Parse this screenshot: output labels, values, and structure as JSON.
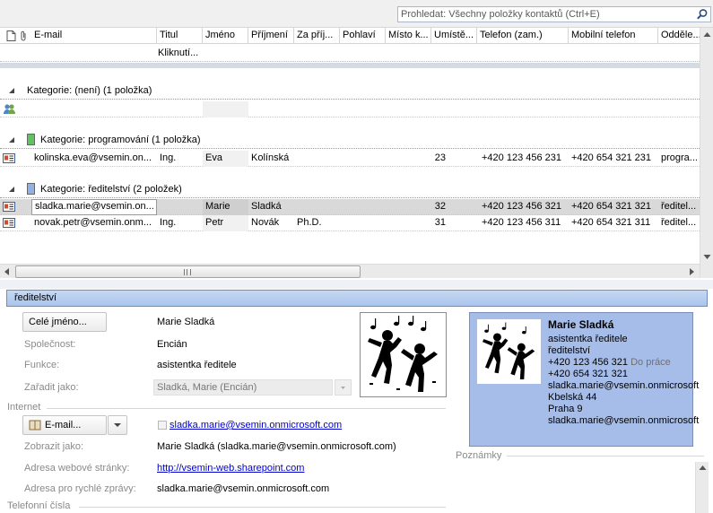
{
  "search": {
    "placeholder": "Prohledat: Všechny položky kontaktů (Ctrl+E)"
  },
  "columns": [
    "E-mail",
    "Titul",
    "Jméno",
    "Příjmení",
    "Za příj...",
    "Pohlaví",
    "Místo k...",
    "Umístě...",
    "Telefon (zam.)",
    "Mobilní telefon",
    "Odděle..."
  ],
  "filter_row": {
    "click_text": "Kliknutí..."
  },
  "groups": [
    {
      "label": "Kategorie: (není) (1 položka)"
    },
    {
      "label": "Kategorie: programování (1 položka)",
      "color": "#5fc35f"
    },
    {
      "label": "Kategorie: ředitelství (2 položek)",
      "color": "#8fb0e8"
    }
  ],
  "rows": [
    {
      "email": "kolinska.eva@vsemin.on...",
      "titul": "Ing.",
      "jmeno": "Eva",
      "prijmeni": "Kolínská",
      "za_prijmeni": "",
      "umisteni": "23",
      "telefon": "+420 123 456 231",
      "mobil": "+420 654 321 231",
      "oddeleni": "progra..."
    },
    {
      "email": "sladka.marie@vsemin.on...",
      "titul": "",
      "jmeno": "Marie",
      "prijmeni": "Sladká",
      "za_prijmeni": "",
      "umisteni": "32",
      "telefon": "+420 123 456 321",
      "mobil": "+420 654 321 321",
      "oddeleni": "ředitel...",
      "selected": true
    },
    {
      "email": "novak.petr@vsemin.onm...",
      "titul": "Ing.",
      "jmeno": "Petr",
      "prijmeni": "Novák",
      "za_prijmeni": "Ph.D.",
      "umisteni": "31",
      "telefon": "+420 123 456 311",
      "mobil": "+420 654 321 311",
      "oddeleni": "ředitel..."
    }
  ],
  "detail": {
    "title": "ředitelství",
    "fullname_button": "Celé jméno...",
    "fullname": "Marie Sladká",
    "company_label": "Společnost:",
    "company": "Encián",
    "function_label": "Funkce:",
    "function": "asistentka ředitele",
    "fileas_label": "Zařadit jako:",
    "fileas": "Sladká, Marie (Encián)",
    "internet_section": "Internet",
    "email_button": "E-mail...",
    "email": "sladka.marie@vsemin.onmicrosoft.com",
    "display_label": "Zobrazit jako:",
    "display": "Marie Sladká (sladka.marie@vsemin.onmicrosoft.com)",
    "web_label": "Adresa webové stránky:",
    "web": "http://vsemin-web.sharepoint.com",
    "im_label": "Adresa pro rychlé zprávy:",
    "im": "sladka.marie@vsemin.onmicrosoft.com",
    "phones_section": "Telefonní čísla",
    "notes_label": "Poznámky"
  },
  "card": {
    "name": "Marie Sladká",
    "function": "asistentka ředitele",
    "department": "ředitelství",
    "phone_work": "+420 123 456 321",
    "phone_work_label": "Do práce",
    "phone_mobile": "+420 654 321 321",
    "email1": "sladka.marie@vsemin.onmicrosoft",
    "street": "Kbelská 44",
    "city": "Praha 9",
    "email2": "sladka.marie@vsemin.onmicrosoft"
  },
  "colors": {
    "accent": "#a9c4ec",
    "card_bg": "#a6bde9",
    "selected_row": "#d9d9d9",
    "link": "#0000cc"
  }
}
